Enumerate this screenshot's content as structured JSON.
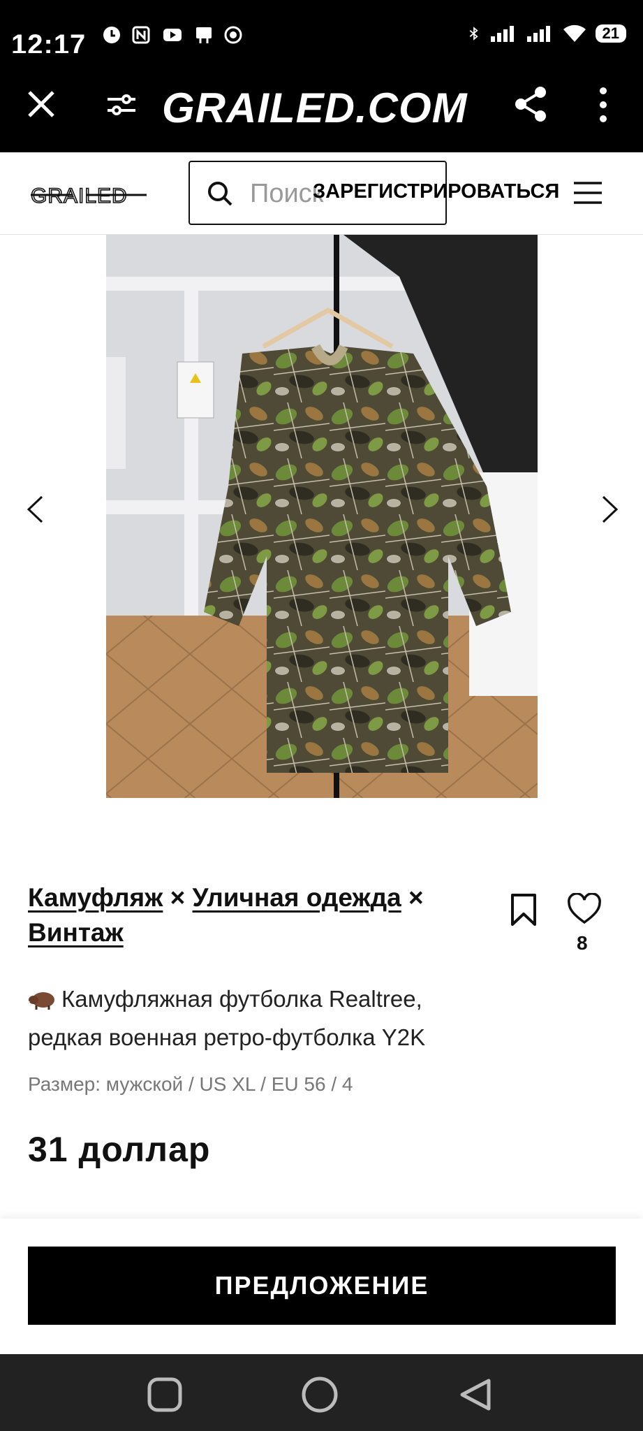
{
  "status_bar": {
    "time": "12:17",
    "battery": "21",
    "left_icons": [
      "alarm-icon",
      "nfc-icon",
      "youtube-icon",
      "notification-icon",
      "record-icon"
    ],
    "right_icons": [
      "bluetooth-icon",
      "signal-icon",
      "signal-icon",
      "wifi-icon"
    ]
  },
  "browser_bar": {
    "title": "GRAILED.COM"
  },
  "site_header": {
    "logo": "GRAILED",
    "search": {
      "placeholder": "Поиск"
    },
    "register_label": "ЗАРЕГИСТРИРОВАТЬСЯ"
  },
  "product": {
    "tags": [
      "Камуфляж",
      "Уличная одежда",
      "Винтаж"
    ],
    "tag_separator": "×",
    "like_count": "8",
    "title_line1": "Камуфляжная футболка Realtree,",
    "title_line2": "редкая военная ретро-футболка Y2K",
    "size": "Размер: мужской / US XL / EU 56 / 4",
    "price": "31 доллар"
  },
  "actions": {
    "offer_label": "ПРЕДЛОЖЕНИЕ"
  },
  "colors": {
    "bar_bg": "#000000",
    "nav_bg": "#222222",
    "accent": "#000000"
  }
}
